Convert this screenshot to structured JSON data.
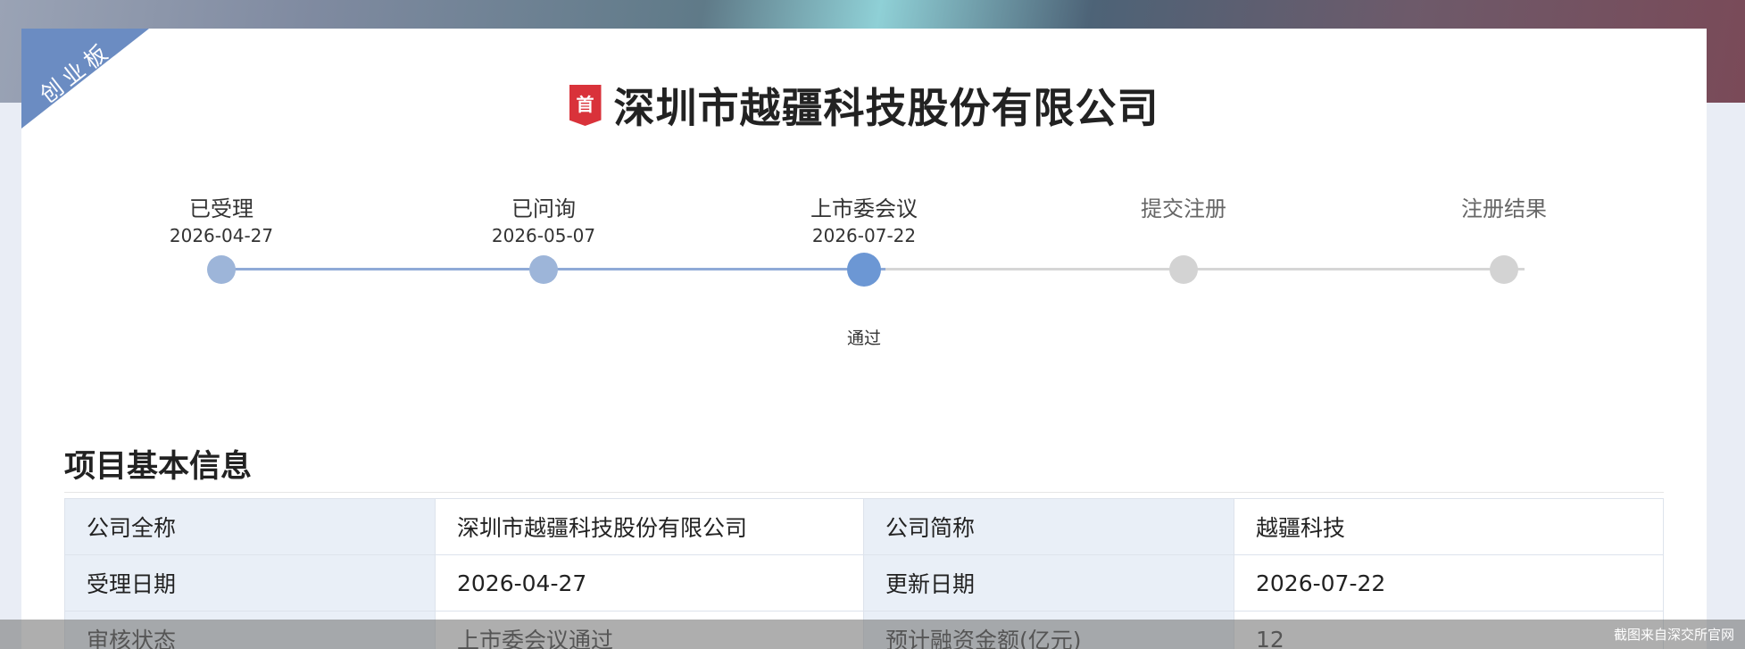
{
  "board_badge": "创业板",
  "title_badge": "首",
  "company_title": "深圳市越疆科技股份有限公司",
  "steps": [
    {
      "label": "已受理",
      "date": "2026-04-27",
      "status": "",
      "state": "done"
    },
    {
      "label": "已问询",
      "date": "2026-05-07",
      "status": "",
      "state": "done"
    },
    {
      "label": "上市委会议",
      "date": "2026-07-22",
      "status": "通过",
      "state": "current"
    },
    {
      "label": "提交注册",
      "date": "",
      "status": "",
      "state": "pending"
    },
    {
      "label": "注册结果",
      "date": "",
      "status": "",
      "state": "pending"
    }
  ],
  "section_title": "项目基本信息",
  "info_rows": [
    {
      "k1": "公司全称",
      "v1": "深圳市越疆科技股份有限公司",
      "k2": "公司简称",
      "v2": "越疆科技"
    },
    {
      "k1": "受理日期",
      "v1": "2026-04-27",
      "k2": "更新日期",
      "v2": "2026-07-22"
    },
    {
      "k1": "审核状态",
      "v1": "上市委会议通过",
      "k2": "预计融资金额(亿元)",
      "v2": "12"
    }
  ],
  "watermark": "截图来自深交所官网",
  "colors": {
    "accent": "#6c97d4",
    "badge_red": "#d9323a",
    "ribbon": "#6b8cc2"
  }
}
